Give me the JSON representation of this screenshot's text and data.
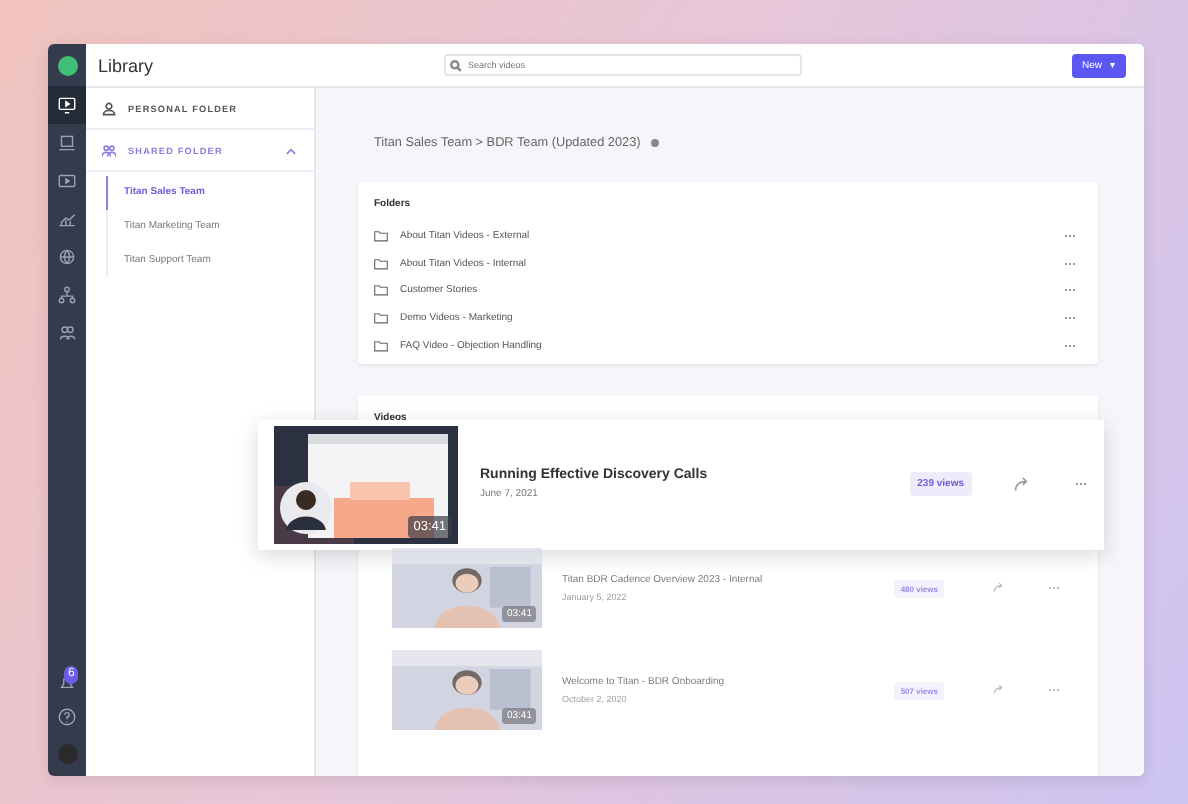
{
  "window": {
    "title": "Library"
  },
  "search": {
    "placeholder": "Search videos"
  },
  "new_button": {
    "label": "New",
    "caret": "▾"
  },
  "rail": {
    "items": [
      {
        "kind": "video",
        "selected": true
      },
      {
        "kind": "laptop",
        "selected": false
      },
      {
        "kind": "player",
        "selected": false
      },
      {
        "kind": "chart",
        "selected": false
      },
      {
        "kind": "globe",
        "selected": false
      },
      {
        "kind": "network",
        "selected": false
      },
      {
        "kind": "people",
        "selected": false
      }
    ],
    "notification_badge": "6"
  },
  "sidebar": {
    "personal_folder": {
      "label": "PERSONAL FOLDER",
      "selected": false
    },
    "shared_folder": {
      "label": "SHARED FOLDER",
      "selected": true,
      "expanded": true,
      "children": [
        {
          "label": "Titan Sales Team",
          "selected": true
        },
        {
          "label": "Titan Marketing Team",
          "selected": false
        },
        {
          "label": "Titan Support Team",
          "selected": false
        }
      ]
    }
  },
  "breadcrumb": "Titan Sales Team > BDR Team (Updated 2023)",
  "folders": {
    "title": "Folders",
    "items": [
      "About Titan Videos - External",
      "About Titan Videos - Internal",
      "Customer Stories",
      "Demo Videos - Marketing",
      "FAQ Video - Objection Handling"
    ]
  },
  "videos": {
    "title": "Videos",
    "items": [
      {
        "title": "Running Effective Discovery Calls",
        "date": "June 7, 2021",
        "duration": "03:41",
        "views": "239 views",
        "dragging": true
      },
      {
        "title": "Titan BDR Cadence Overview 2023 - Internal",
        "date": "January 5, 2022",
        "duration": "03:41",
        "views": "480 views",
        "dragging": false
      },
      {
        "title": "Welcome to Titan - BDR Onboarding",
        "date": "October 2, 2020",
        "duration": "03:41",
        "views": "507 views",
        "dragging": false
      }
    ]
  }
}
